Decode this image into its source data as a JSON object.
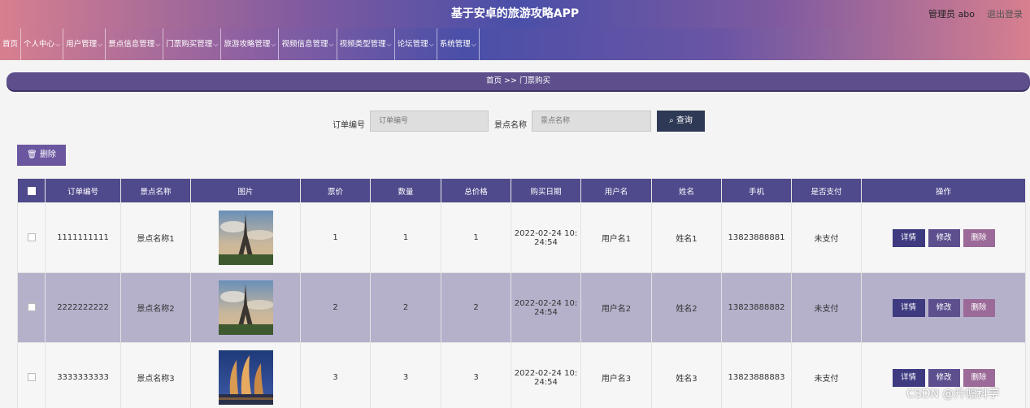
{
  "header": {
    "title": "基于安卓的旅游攻略APP",
    "user": "管理员 abo",
    "logout": "退出登录"
  },
  "nav": {
    "items": [
      {
        "label": "首页",
        "dropdown": false
      },
      {
        "label": "个人中心",
        "dropdown": true
      },
      {
        "label": "用户管理",
        "dropdown": true
      },
      {
        "label": "景点信息管理",
        "dropdown": true
      },
      {
        "label": "门票购买管理",
        "dropdown": true
      },
      {
        "label": "旅游攻略管理",
        "dropdown": true
      },
      {
        "label": "视频信息管理",
        "dropdown": true
      },
      {
        "label": "视频类型管理",
        "dropdown": true
      },
      {
        "label": "论坛管理",
        "dropdown": true
      },
      {
        "label": "系统管理",
        "dropdown": true
      }
    ]
  },
  "breadcrumb": "首页  >>  门票购买",
  "search": {
    "order_label": "订单编号",
    "order_placeholder": "订单编号",
    "spot_label": "景点名称",
    "spot_placeholder": "景点名称",
    "query_button": "查询"
  },
  "toolbar": {
    "delete_label": "删除"
  },
  "table": {
    "columns": [
      "订单编号",
      "景点名称",
      "图片",
      "票价",
      "数量",
      "总价格",
      "购买日期",
      "用户名",
      "姓名",
      "手机",
      "是否支付",
      "操作"
    ],
    "rows": [
      {
        "order_no": "1111111111",
        "spot": "景点名称1",
        "image": "eiffel-tower",
        "price": "1",
        "qty": "1",
        "total": "1",
        "date": "2022-02-24 10:\n24:54",
        "username": "用户名1",
        "name": "姓名1",
        "phone": "13823888881",
        "paid": "未支付"
      },
      {
        "order_no": "2222222222",
        "spot": "景点名称2",
        "image": "eiffel-tower",
        "price": "2",
        "qty": "2",
        "total": "2",
        "date": "2022-02-24 10:\n24:54",
        "username": "用户名2",
        "name": "姓名2",
        "phone": "13823888882",
        "paid": "未支付"
      },
      {
        "order_no": "3333333333",
        "spot": "景点名称3",
        "image": "sail-buildings-night",
        "price": "3",
        "qty": "3",
        "total": "3",
        "date": "2022-02-24 10:\n24:54",
        "username": "用户名3",
        "name": "姓名3",
        "phone": "13823888883",
        "paid": "未支付"
      }
    ],
    "actions": {
      "detail": "详情",
      "edit": "修改",
      "delete": "删除"
    }
  },
  "watermark": "CSDN @升幅科学",
  "colors": {
    "header_accent": "#4a4fa8",
    "table_header": "#4f4a8c",
    "selected_row": "#b5b1cb"
  }
}
